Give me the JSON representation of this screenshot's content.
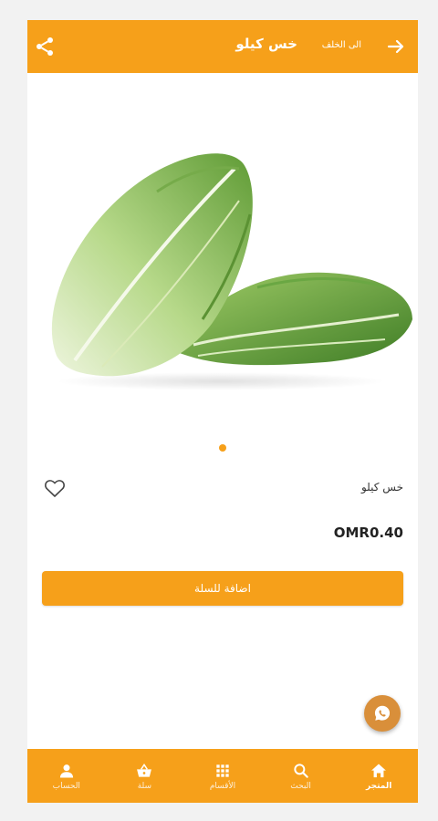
{
  "header": {
    "title": "خس كيلو",
    "back_label": "الى الخلف",
    "accent": "#f6a01a"
  },
  "product": {
    "name": "خس كيلو",
    "price": "OMR0.40",
    "add_to_cart_label": "اضافة للسلة",
    "image_icon": "lettuce-image"
  },
  "bottom_nav": {
    "items": [
      {
        "label": "الحساب",
        "icon": "person-icon"
      },
      {
        "label": "سلة",
        "icon": "basket-icon"
      },
      {
        "label": "الأقسام",
        "icon": "grid-icon"
      },
      {
        "label": "البحث",
        "icon": "search-icon"
      },
      {
        "label": "المتجر",
        "icon": "home-icon"
      }
    ]
  }
}
